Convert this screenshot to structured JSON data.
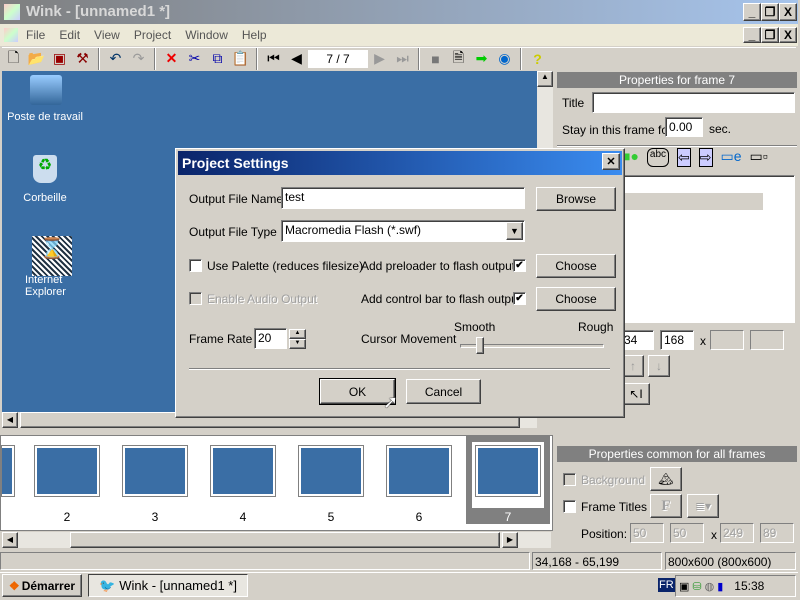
{
  "window": {
    "title": "Wink - [unnamed1 *]",
    "min": "_",
    "max": "❐",
    "close": "X"
  },
  "menu": [
    "File",
    "Edit",
    "View",
    "Project",
    "Window",
    "Help"
  ],
  "toolbar": {
    "frame_counter": "7 / 7"
  },
  "desktop": {
    "icons": [
      "Poste de travail",
      "Corbeille",
      "Internet Explorer"
    ]
  },
  "filmstrip": {
    "frames": [
      "2",
      "3",
      "4",
      "5",
      "6",
      "7"
    ],
    "selected": "7"
  },
  "frame_props": {
    "header": "Properties for frame 7",
    "title_label": "Title",
    "title_value": "",
    "stay_label": "Stay in this frame for",
    "stay_value": "0.00",
    "stay_unit": "sec.",
    "pos_x": "34",
    "pos_y": "168",
    "x_sep": "x",
    "w": "",
    "h": ""
  },
  "common_props": {
    "header": "Properties common for all frames",
    "background_label": "Background",
    "background_checked": false,
    "frame_titles_label": "Frame Titles",
    "frame_titles_checked": false,
    "font_btn": "F",
    "position_label": "Position:",
    "pos": [
      "50",
      "50",
      "249",
      "89"
    ],
    "x_sep": "x"
  },
  "status": {
    "left": "",
    "coords": "34,168 - 65,199",
    "resolution": "800x600 (800x600)"
  },
  "taskbar": {
    "start": "Démarrer",
    "task": "Wink - [unnamed1 *]",
    "lang": "FR",
    "clock": "15:38"
  },
  "dialog": {
    "title": "Project Settings",
    "close": "✕",
    "output_name_label": "Output File Name",
    "output_name_value": "test",
    "browse": "Browse",
    "output_type_label": "Output File Type",
    "output_type_value": "Macromedia Flash (*.swf)",
    "use_palette_label": "Use Palette (reduces filesize)",
    "use_palette_checked": false,
    "preloader_label": "Add preloader to flash output",
    "preloader_checked": true,
    "choose1": "Choose",
    "audio_label": "Enable Audio Output",
    "audio_checked": false,
    "controlbar_label": "Add control bar to flash output",
    "controlbar_checked": true,
    "choose2": "Choose",
    "frame_rate_label": "Frame Rate",
    "frame_rate_value": "20",
    "cursor_label": "Cursor Movement",
    "smooth": "Smooth",
    "rough": "Rough",
    "cursor_slider": 0.12,
    "ok": "OK",
    "cancel": "Cancel",
    "check": "✔"
  }
}
